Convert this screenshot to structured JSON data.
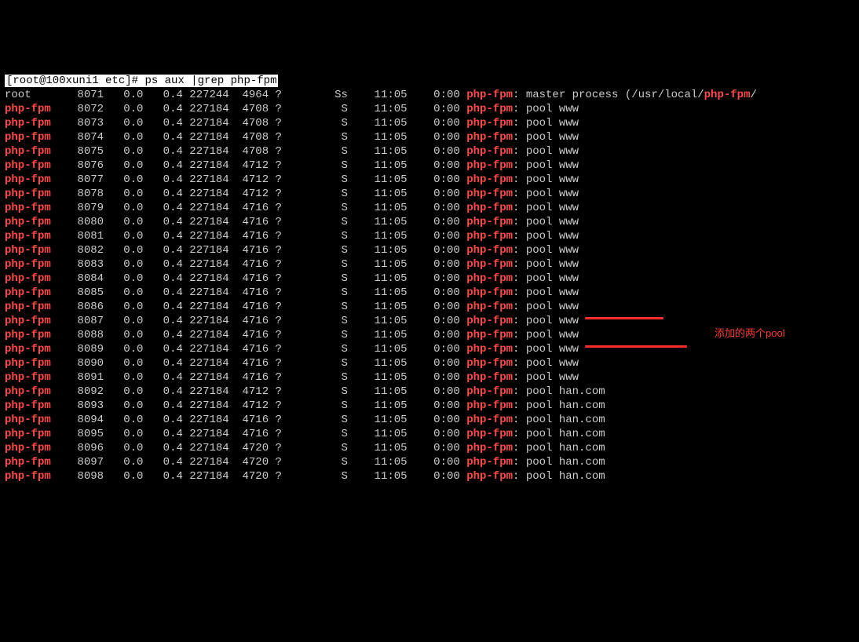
{
  "prompt": {
    "text": "[root@100xuni1 etc]# ",
    "command": "ps aux |grep php-fpm"
  },
  "header_fragment": "",
  "columns": {
    "user_root": "root",
    "user_phpfpm": "php-fpm",
    "stat_master": "Ss",
    "stat_child": "S",
    "tty": "?",
    "start": "11:05",
    "time": "0:00",
    "proc_name": "php-fpm",
    "master_suffix_a": ": master process (/usr/local/",
    "master_suffix_b": "php-fpm",
    "master_suffix_c": "/",
    "pool_www": ": pool www",
    "pool_han": ": pool han.com"
  },
  "rows": [
    {
      "user": "root",
      "pid": "8071",
      "cpu": "0.0",
      "mem": "0.4",
      "vsz": "227244",
      "rss": "4964",
      "stat": "Ss",
      "cmd": "master"
    },
    {
      "user": "php-fpm",
      "pid": "8072",
      "cpu": "0.0",
      "mem": "0.4",
      "vsz": "227184",
      "rss": "4708",
      "stat": "S",
      "cmd": "www"
    },
    {
      "user": "php-fpm",
      "pid": "8073",
      "cpu": "0.0",
      "mem": "0.4",
      "vsz": "227184",
      "rss": "4708",
      "stat": "S",
      "cmd": "www"
    },
    {
      "user": "php-fpm",
      "pid": "8074",
      "cpu": "0.0",
      "mem": "0.4",
      "vsz": "227184",
      "rss": "4708",
      "stat": "S",
      "cmd": "www"
    },
    {
      "user": "php-fpm",
      "pid": "8075",
      "cpu": "0.0",
      "mem": "0.4",
      "vsz": "227184",
      "rss": "4708",
      "stat": "S",
      "cmd": "www"
    },
    {
      "user": "php-fpm",
      "pid": "8076",
      "cpu": "0.0",
      "mem": "0.4",
      "vsz": "227184",
      "rss": "4712",
      "stat": "S",
      "cmd": "www"
    },
    {
      "user": "php-fpm",
      "pid": "8077",
      "cpu": "0.0",
      "mem": "0.4",
      "vsz": "227184",
      "rss": "4712",
      "stat": "S",
      "cmd": "www"
    },
    {
      "user": "php-fpm",
      "pid": "8078",
      "cpu": "0.0",
      "mem": "0.4",
      "vsz": "227184",
      "rss": "4712",
      "stat": "S",
      "cmd": "www"
    },
    {
      "user": "php-fpm",
      "pid": "8079",
      "cpu": "0.0",
      "mem": "0.4",
      "vsz": "227184",
      "rss": "4716",
      "stat": "S",
      "cmd": "www"
    },
    {
      "user": "php-fpm",
      "pid": "8080",
      "cpu": "0.0",
      "mem": "0.4",
      "vsz": "227184",
      "rss": "4716",
      "stat": "S",
      "cmd": "www"
    },
    {
      "user": "php-fpm",
      "pid": "8081",
      "cpu": "0.0",
      "mem": "0.4",
      "vsz": "227184",
      "rss": "4716",
      "stat": "S",
      "cmd": "www"
    },
    {
      "user": "php-fpm",
      "pid": "8082",
      "cpu": "0.0",
      "mem": "0.4",
      "vsz": "227184",
      "rss": "4716",
      "stat": "S",
      "cmd": "www"
    },
    {
      "user": "php-fpm",
      "pid": "8083",
      "cpu": "0.0",
      "mem": "0.4",
      "vsz": "227184",
      "rss": "4716",
      "stat": "S",
      "cmd": "www"
    },
    {
      "user": "php-fpm",
      "pid": "8084",
      "cpu": "0.0",
      "mem": "0.4",
      "vsz": "227184",
      "rss": "4716",
      "stat": "S",
      "cmd": "www"
    },
    {
      "user": "php-fpm",
      "pid": "8085",
      "cpu": "0.0",
      "mem": "0.4",
      "vsz": "227184",
      "rss": "4716",
      "stat": "S",
      "cmd": "www"
    },
    {
      "user": "php-fpm",
      "pid": "8086",
      "cpu": "0.0",
      "mem": "0.4",
      "vsz": "227184",
      "rss": "4716",
      "stat": "S",
      "cmd": "www"
    },
    {
      "user": "php-fpm",
      "pid": "8087",
      "cpu": "0.0",
      "mem": "0.4",
      "vsz": "227184",
      "rss": "4716",
      "stat": "S",
      "cmd": "www"
    },
    {
      "user": "php-fpm",
      "pid": "8088",
      "cpu": "0.0",
      "mem": "0.4",
      "vsz": "227184",
      "rss": "4716",
      "stat": "S",
      "cmd": "www"
    },
    {
      "user": "php-fpm",
      "pid": "8089",
      "cpu": "0.0",
      "mem": "0.4",
      "vsz": "227184",
      "rss": "4716",
      "stat": "S",
      "cmd": "www"
    },
    {
      "user": "php-fpm",
      "pid": "8090",
      "cpu": "0.0",
      "mem": "0.4",
      "vsz": "227184",
      "rss": "4716",
      "stat": "S",
      "cmd": "www"
    },
    {
      "user": "php-fpm",
      "pid": "8091",
      "cpu": "0.0",
      "mem": "0.4",
      "vsz": "227184",
      "rss": "4716",
      "stat": "S",
      "cmd": "www"
    },
    {
      "user": "php-fpm",
      "pid": "8092",
      "cpu": "0.0",
      "mem": "0.4",
      "vsz": "227184",
      "rss": "4712",
      "stat": "S",
      "cmd": "han"
    },
    {
      "user": "php-fpm",
      "pid": "8093",
      "cpu": "0.0",
      "mem": "0.4",
      "vsz": "227184",
      "rss": "4712",
      "stat": "S",
      "cmd": "han"
    },
    {
      "user": "php-fpm",
      "pid": "8094",
      "cpu": "0.0",
      "mem": "0.4",
      "vsz": "227184",
      "rss": "4716",
      "stat": "S",
      "cmd": "han"
    },
    {
      "user": "php-fpm",
      "pid": "8095",
      "cpu": "0.0",
      "mem": "0.4",
      "vsz": "227184",
      "rss": "4716",
      "stat": "S",
      "cmd": "han"
    },
    {
      "user": "php-fpm",
      "pid": "8096",
      "cpu": "0.0",
      "mem": "0.4",
      "vsz": "227184",
      "rss": "4720",
      "stat": "S",
      "cmd": "han"
    },
    {
      "user": "php-fpm",
      "pid": "8097",
      "cpu": "0.0",
      "mem": "0.4",
      "vsz": "227184",
      "rss": "4720",
      "stat": "S",
      "cmd": "han"
    },
    {
      "user": "php-fpm",
      "pid": "8098",
      "cpu": "0.0",
      "mem": "0.4",
      "vsz": "227184",
      "rss": "4720",
      "stat": "S",
      "cmd": "han"
    }
  ],
  "annotation": {
    "text": "添加的两个pool"
  }
}
